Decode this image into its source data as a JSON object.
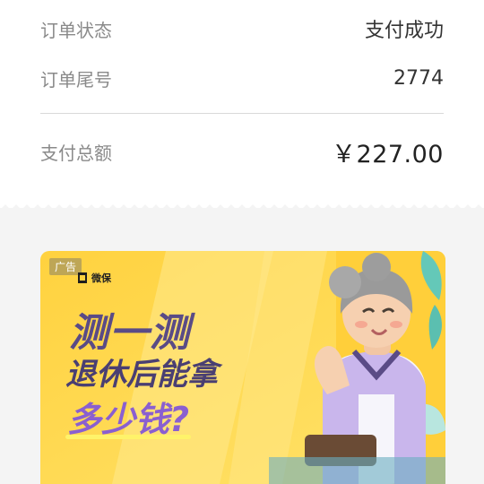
{
  "order": {
    "status_label": "订单状态",
    "status_value": "支付成功",
    "tail_label": "订单尾号",
    "tail_value": "2774",
    "total_label": "支付总额",
    "total_value": "￥227.00"
  },
  "ad": {
    "badge": "广告",
    "brand": "微保",
    "headline_1": "测一测",
    "headline_2": "退休后能拿",
    "headline_3": "多少钱?",
    "colors": {
      "background": "#ffd84a",
      "accent": "#8a5fd0"
    }
  }
}
